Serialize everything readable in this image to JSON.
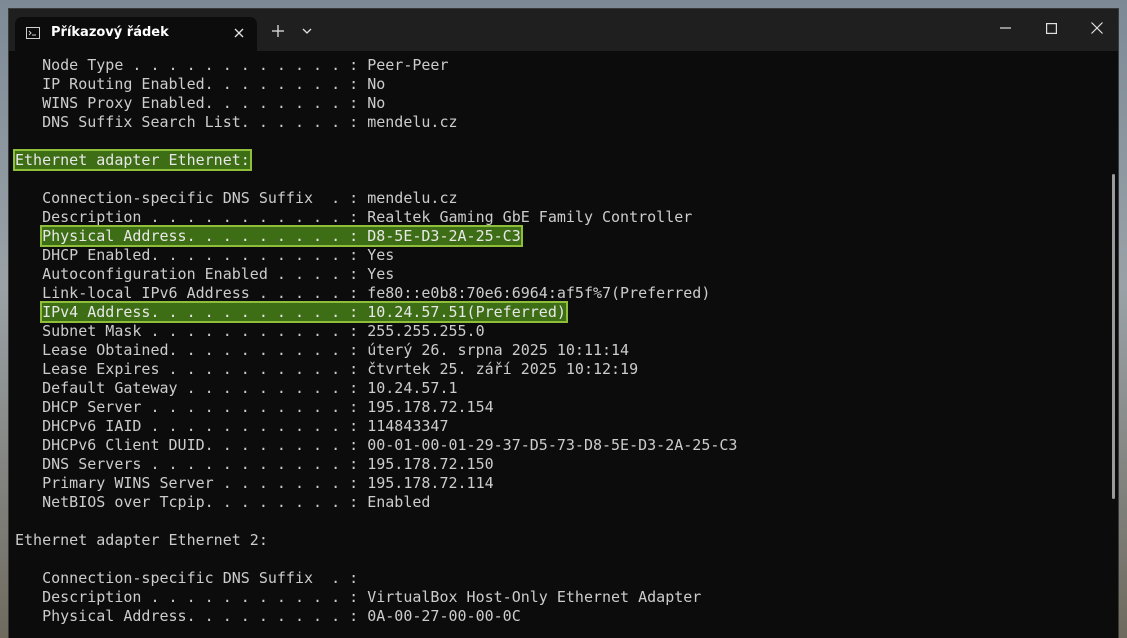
{
  "window": {
    "tab_title": "Příkazový řádek"
  },
  "icons": {
    "tab_icon": "cmd-icon",
    "close": "close-icon",
    "new_tab": "plus-icon",
    "dropdown": "chevron-down-icon",
    "minimize": "minimize-icon",
    "maximize": "maximize-icon",
    "window_close": "close-icon"
  },
  "colors": {
    "terminal_bg": "#0c0c0c",
    "terminal_text": "#cccccc",
    "highlight_bg": "#3d6d14",
    "highlight_border": "#8fbf3a"
  },
  "terminal": {
    "lines": [
      "   Node Type . . . . . . . . . . . . : Peer-Peer",
      "   IP Routing Enabled. . . . . . . . : No",
      "   WINS Proxy Enabled. . . . . . . . : No",
      "   DNS Suffix Search List. . . . . . : mendelu.cz",
      "",
      "Ethernet adapter Ethernet:",
      "",
      "   Connection-specific DNS Suffix  . : mendelu.cz",
      "   Description . . . . . . . . . . . : Realtek Gaming GbE Family Controller",
      "   Physical Address. . . . . . . . . : D8-5E-D3-2A-25-C3",
      "   DHCP Enabled. . . . . . . . . . . : Yes",
      "   Autoconfiguration Enabled . . . . : Yes",
      "   Link-local IPv6 Address . . . . . : fe80::e0b8:70e6:6964:af5f%7(Preferred)",
      "   IPv4 Address. . . . . . . . . . . : 10.24.57.51(Preferred)",
      "   Subnet Mask . . . . . . . . . . . : 255.255.255.0",
      "   Lease Obtained. . . . . . . . . . : úterý 26. srpna 2025 10:11:14",
      "   Lease Expires . . . . . . . . . . : čtvrtek 25. září 2025 10:12:19",
      "   Default Gateway . . . . . . . . . : 10.24.57.1",
      "   DHCP Server . . . . . . . . . . . : 195.178.72.154",
      "   DHCPv6 IAID . . . . . . . . . . . : 114843347",
      "   DHCPv6 Client DUID. . . . . . . . : 00-01-00-01-29-37-D5-73-D8-5E-D3-2A-25-C3",
      "   DNS Servers . . . . . . . . . . . : 195.178.72.150",
      "   Primary WINS Server . . . . . . . : 195.178.72.114",
      "   NetBIOS over Tcpip. . . . . . . . : Enabled",
      "",
      "Ethernet adapter Ethernet 2:",
      "",
      "   Connection-specific DNS Suffix  . :",
      "   Description . . . . . . . . . . . : VirtualBox Host-Only Ethernet Adapter",
      "   Physical Address. . . . . . . . . : 0A-00-27-00-00-0C"
    ],
    "highlights": {
      "header": "Ethernet adapter Ethernet:",
      "physical": "Physical Address. . . . . . . . . : D8-5E-D3-2A-25-C3",
      "ipv4": "IPv4 Address. . . . . . . . . . . : 10.24.57.51(Preferred)"
    }
  }
}
